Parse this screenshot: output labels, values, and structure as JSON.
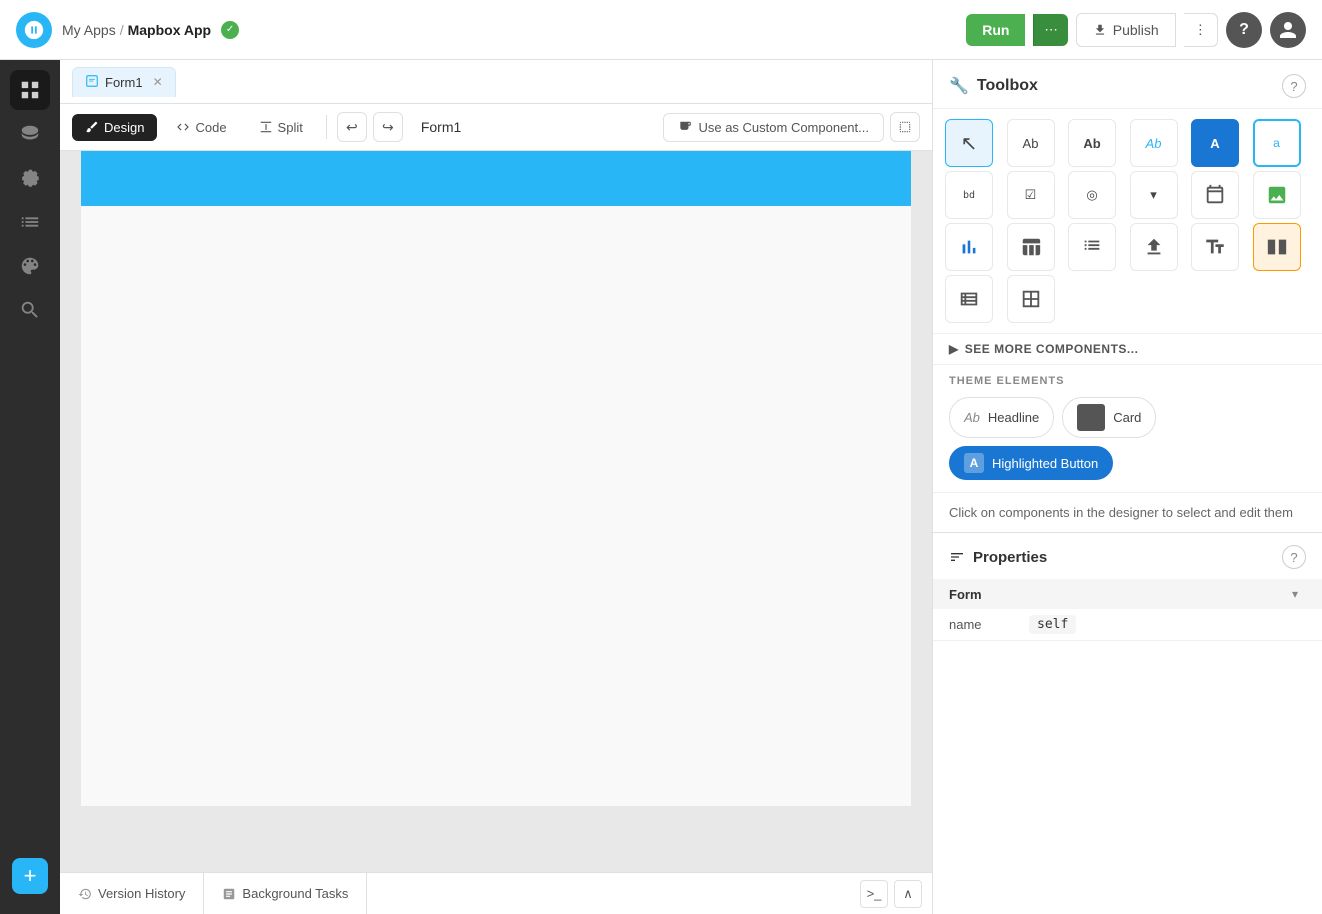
{
  "app": {
    "logo_text": "★",
    "breadcrumb_parent": "My Apps",
    "breadcrumb_sep": "/",
    "breadcrumb_current": "Mapbox App",
    "status": "connected"
  },
  "topbar": {
    "run_label": "Run",
    "publish_label": "Publish",
    "help_icon": "?",
    "more_icon": "⋯"
  },
  "tabs": [
    {
      "label": "Form1",
      "icon": "☐",
      "active": true
    }
  ],
  "toolbar": {
    "design_label": "Design",
    "code_label": "Code",
    "split_label": "Split",
    "form_title": "Form1",
    "custom_component_label": "Use as Custom Component..."
  },
  "toolbox": {
    "title": "Toolbox",
    "see_more_label": "SEE MORE COMPONENTS...",
    "tools": [
      {
        "id": "cursor",
        "symbol": "↖",
        "label": "Cursor"
      },
      {
        "id": "text-ab1",
        "symbol": "Ab",
        "label": "Text normal"
      },
      {
        "id": "text-ab2",
        "symbol": "Ab",
        "label": "Text bold"
      },
      {
        "id": "text-ab3",
        "symbol": "Ab",
        "label": "Text italic"
      },
      {
        "id": "text-A-blue",
        "symbol": "A",
        "label": "Text highlighted"
      },
      {
        "id": "text-a-outline",
        "symbol": "a",
        "label": "Text outline"
      },
      {
        "id": "input-bd",
        "symbol": "bd",
        "label": "Input field"
      },
      {
        "id": "checkbox",
        "symbol": "☑",
        "label": "Checkbox"
      },
      {
        "id": "radio",
        "symbol": "◎",
        "label": "Radio button"
      },
      {
        "id": "dropdown",
        "symbol": "▼",
        "label": "Dropdown"
      },
      {
        "id": "calendar",
        "symbol": "▦",
        "label": "Calendar"
      },
      {
        "id": "image",
        "symbol": "🖼",
        "label": "Image"
      },
      {
        "id": "chart",
        "symbol": "📊",
        "label": "Chart"
      },
      {
        "id": "table",
        "symbol": "⊞",
        "label": "Table"
      },
      {
        "id": "list",
        "symbol": "⋯",
        "label": "List"
      },
      {
        "id": "upload",
        "symbol": "⬆",
        "label": "Upload"
      },
      {
        "id": "text-field",
        "symbol": "⊤",
        "label": "Text field"
      },
      {
        "id": "columns",
        "symbol": "⊞",
        "label": "Columns"
      },
      {
        "id": "layout1",
        "symbol": "≡",
        "label": "Layout 1"
      },
      {
        "id": "layout2",
        "symbol": "≣",
        "label": "Layout 2"
      }
    ],
    "theme_elements_label": "THEME ELEMENTS",
    "theme_items": [
      {
        "id": "headline",
        "icon": "Ab",
        "label": "Headline"
      },
      {
        "id": "card",
        "icon": "⊞",
        "label": "Card"
      },
      {
        "id": "highlighted-button",
        "icon": "A",
        "label": "Highlighted Button",
        "style": "highlighted"
      }
    ]
  },
  "info_text": "Click on components in the designer to select and edit them",
  "properties": {
    "title": "Properties",
    "form_dropdown": "Form",
    "rows": [
      {
        "name": "name",
        "value": "self"
      }
    ]
  },
  "bottom": {
    "version_history_label": "Version History",
    "background_tasks_label": "Background Tasks"
  }
}
